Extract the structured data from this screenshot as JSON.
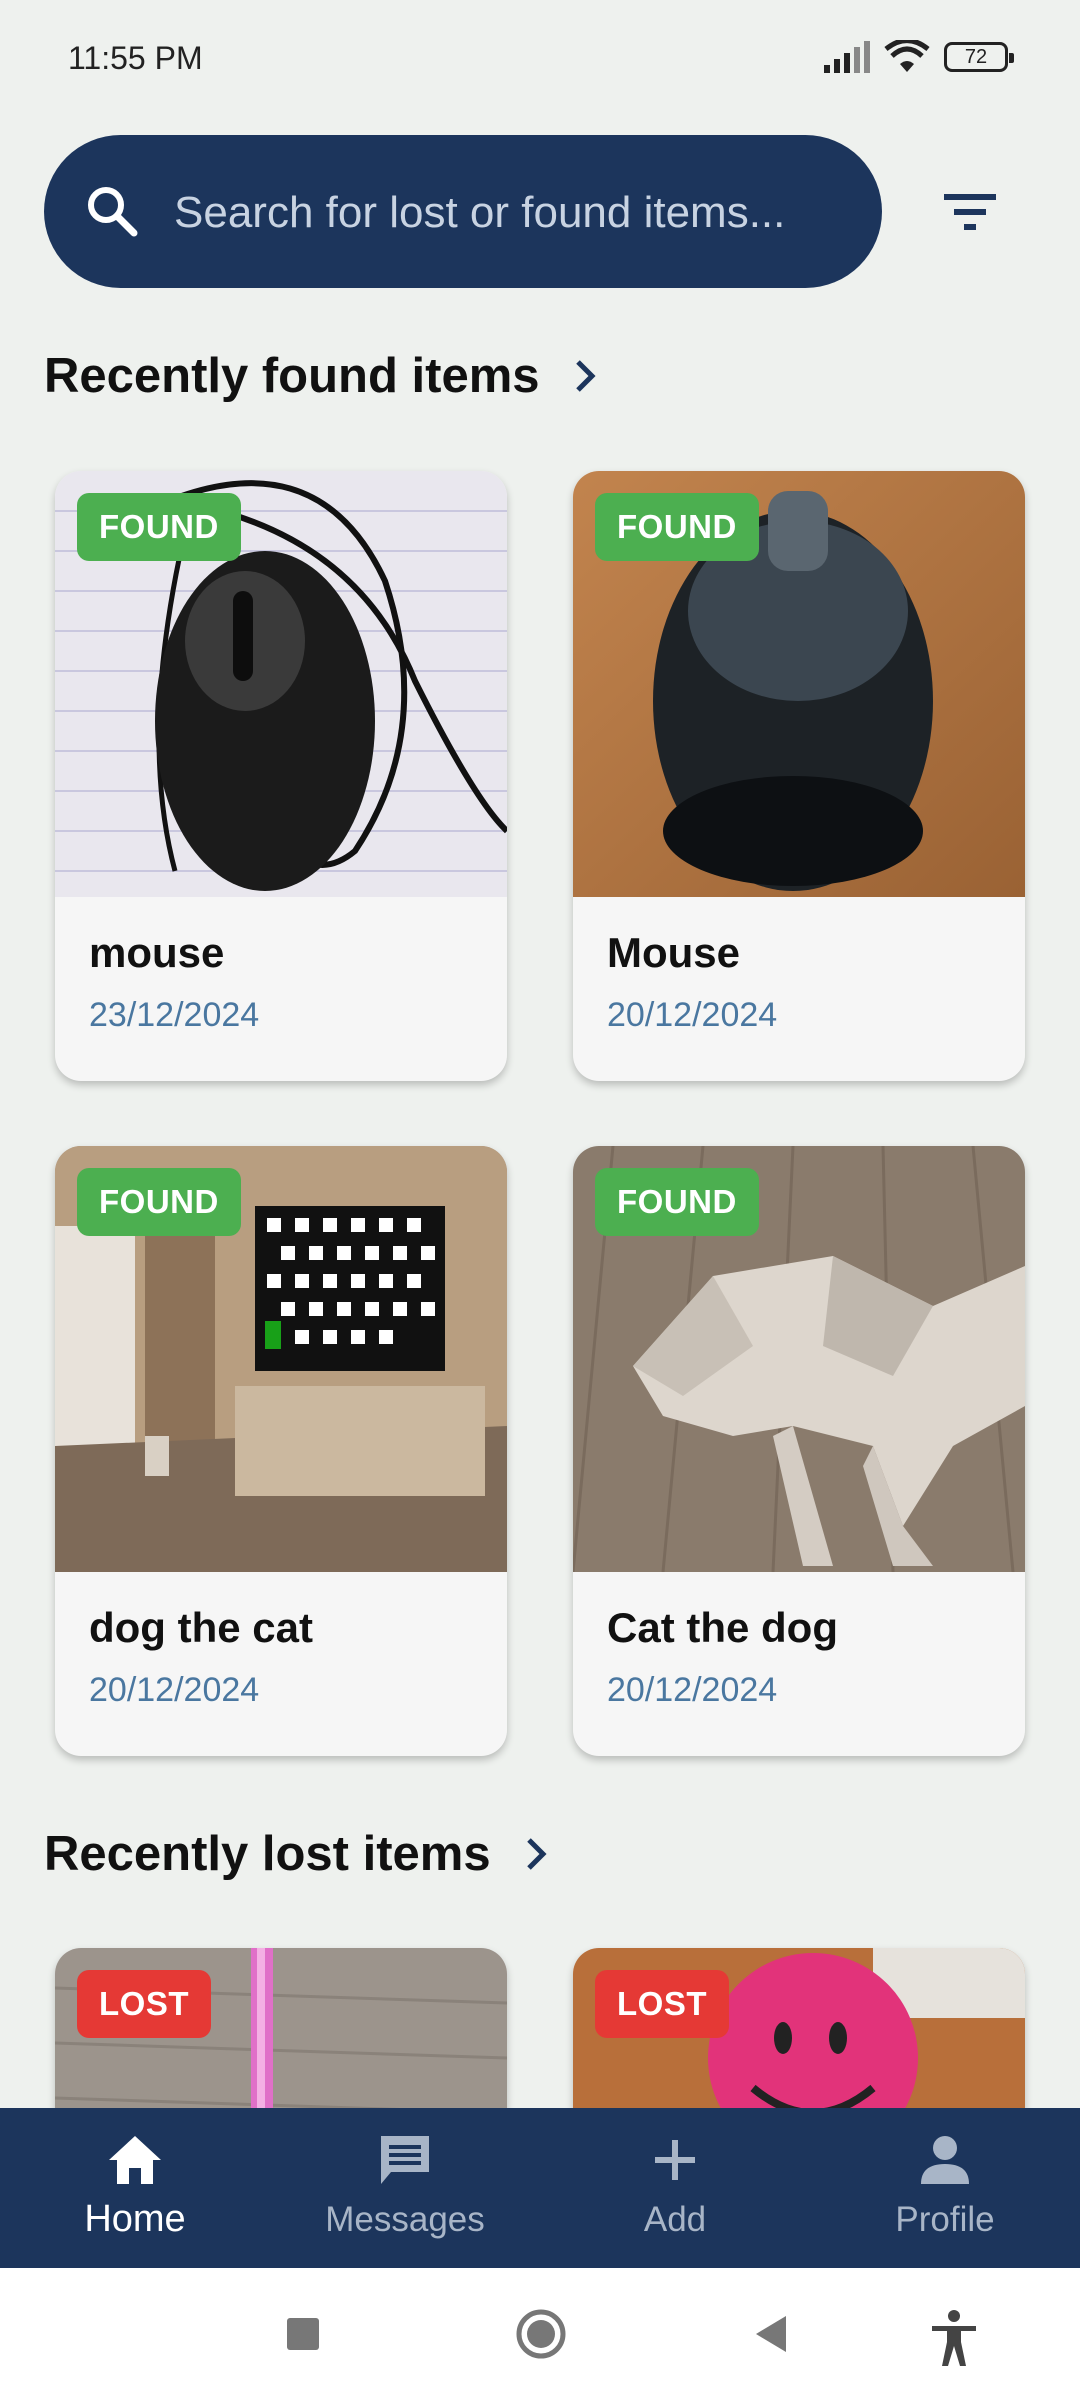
{
  "status_bar": {
    "time": "11:55 PM",
    "battery": "72"
  },
  "search": {
    "placeholder": "Search for lost or found items..."
  },
  "found_section": {
    "title": "Recently found items"
  },
  "found_items": [
    {
      "title": "mouse",
      "date": "23/12/2024",
      "status": "FOUND"
    },
    {
      "title": "Mouse",
      "date": "20/12/2024",
      "status": "FOUND"
    },
    {
      "title": "dog the cat",
      "date": "20/12/2024",
      "status": "FOUND"
    },
    {
      "title": "Cat the dog",
      "date": "20/12/2024",
      "status": "FOUND"
    }
  ],
  "lost_section": {
    "title": "Recently lost items"
  },
  "lost_items": [
    {
      "status": "LOST"
    },
    {
      "status": "LOST"
    }
  ],
  "bottom_nav": {
    "items": [
      {
        "label": "Home",
        "icon": "home-icon",
        "active": true
      },
      {
        "label": "Messages",
        "icon": "message-icon",
        "active": false
      },
      {
        "label": "Add",
        "icon": "plus-icon",
        "active": false
      },
      {
        "label": "Profile",
        "icon": "person-icon",
        "active": false
      }
    ]
  },
  "colors": {
    "primary": "#1c355c",
    "found": "#4caf50",
    "lost": "#e53935",
    "date": "#4a77a0",
    "background": "#eef1ee"
  }
}
